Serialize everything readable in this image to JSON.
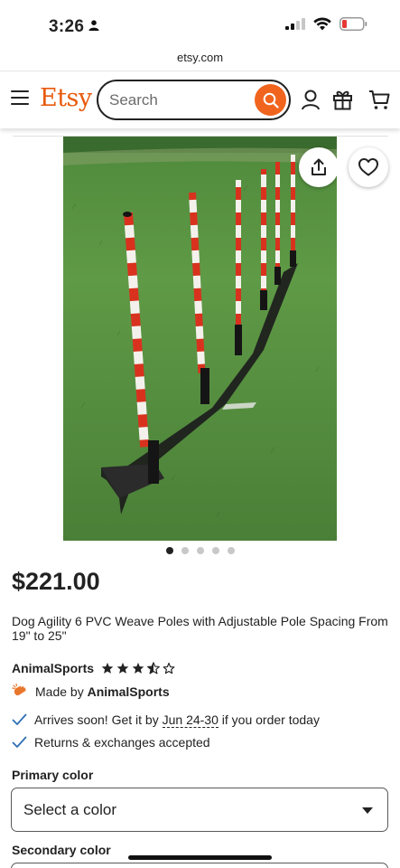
{
  "status": {
    "time": "3:26"
  },
  "browser": {
    "url": "etsy.com"
  },
  "header": {
    "logo": "Etsy",
    "search_placeholder": "Search"
  },
  "gallery": {
    "image_count": 5,
    "active_index": 0
  },
  "product": {
    "price": "$221.00",
    "title": "Dog Agility 6 PVC Weave Poles with Adjustable Pole Spacing From 19\" to 25\"",
    "shop_name": "AnimalSports",
    "rating": 3.5,
    "made_by_prefix": "Made by",
    "made_by_name": "AnimalSports",
    "arrival_prefix": "Arrives soon! Get it by",
    "arrival_dates": "Jun 24-30",
    "arrival_suffix": "if you order today",
    "returns": "Returns & exchanges accepted"
  },
  "options": {
    "primary_label": "Primary color",
    "primary_value": "Select a color",
    "secondary_label": "Secondary color"
  },
  "colors": {
    "etsy_orange": "#f1641e",
    "text": "#222222",
    "check_blue": "#2f6fb5"
  }
}
